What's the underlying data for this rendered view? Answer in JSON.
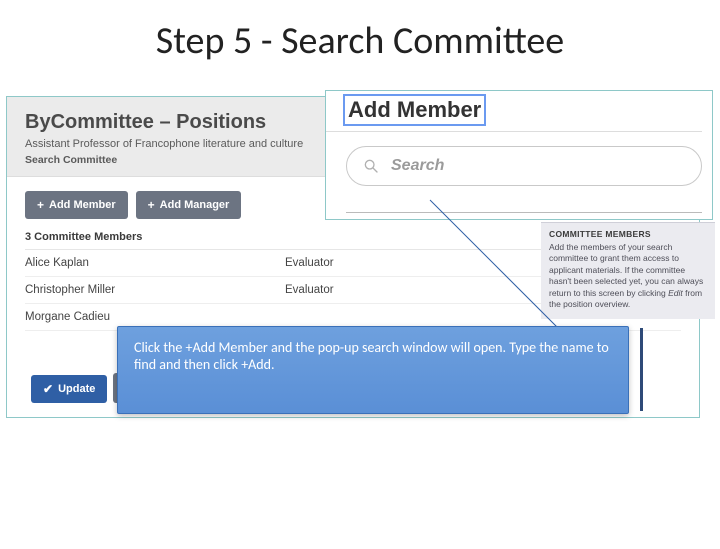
{
  "slide_title": "Step 5 - Search Committee",
  "header": {
    "title": "ByCommittee – Positions",
    "subtitle": "Assistant Professor of Francophone literature and culture",
    "crumb": "Search Committee"
  },
  "toolbar": {
    "add_member_label": "Add Member",
    "add_manager_label": "Add Manager"
  },
  "members": {
    "count_label": "3 Committee Members",
    "rows": [
      {
        "name": "Alice Kaplan",
        "role": "Evaluator"
      },
      {
        "name": "Christopher Miller",
        "role": "Evaluator"
      },
      {
        "name": "Morgane Cadieu",
        "role": ""
      }
    ]
  },
  "update_label": "Update",
  "helper": {
    "title": "COMMITTEE MEMBERS",
    "body_prefix": "Add the members of your search committee to grant them access to applicant materials. If the committee hasn't been selected yet, you can always return to this screen by clicking ",
    "body_em": "Edit",
    "body_suffix": " from the position overview."
  },
  "popup": {
    "title": "Add Member",
    "search_placeholder": "Search"
  },
  "callout": {
    "text": "Click the +Add Member and the pop-up search window will open. Type the name to find and then click +Add."
  }
}
